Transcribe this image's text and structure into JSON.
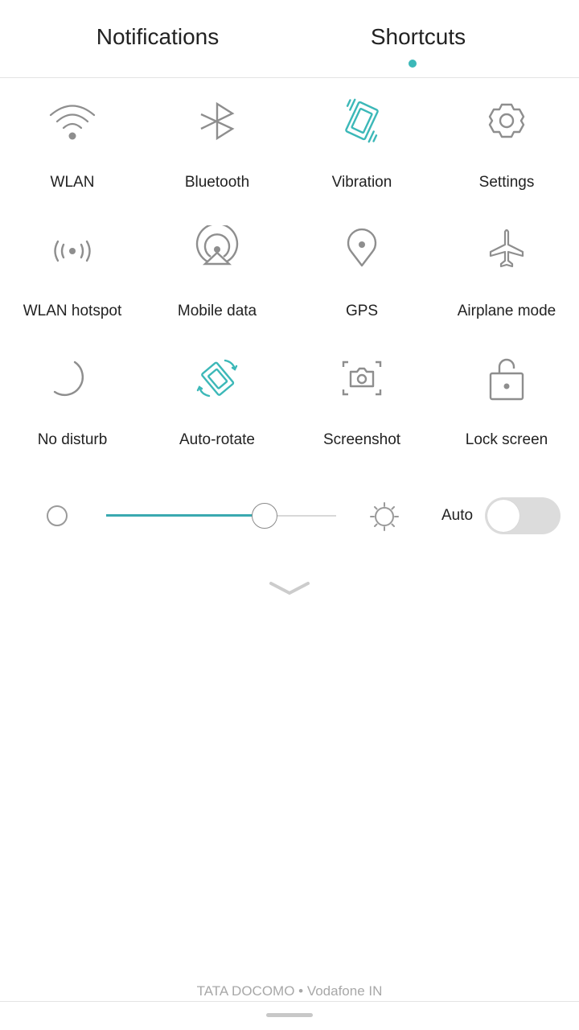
{
  "tabs": [
    {
      "label": "Notifications",
      "active": false
    },
    {
      "label": "Shortcuts",
      "active": true
    }
  ],
  "colors": {
    "accent": "#3cb8b8",
    "icon_inactive": "#8e8e8e",
    "slider_fill": "#3aa9b0"
  },
  "shortcuts": [
    {
      "label": "WLAN",
      "icon": "wifi-icon",
      "active": false
    },
    {
      "label": "Bluetooth",
      "icon": "bluetooth-icon",
      "active": false
    },
    {
      "label": "Vibration",
      "icon": "vibration-icon",
      "active": true
    },
    {
      "label": "Settings",
      "icon": "gear-icon",
      "active": false
    },
    {
      "label": "WLAN hotspot",
      "icon": "hotspot-icon",
      "active": false
    },
    {
      "label": "Mobile data",
      "icon": "mobile-data-icon",
      "active": false
    },
    {
      "label": "GPS",
      "icon": "location-pin-icon",
      "active": false
    },
    {
      "label": "Airplane mode",
      "icon": "airplane-icon",
      "active": false
    },
    {
      "label": "No disturb",
      "icon": "moon-icon",
      "active": false
    },
    {
      "label": "Auto-rotate",
      "icon": "auto-rotate-icon",
      "active": true
    },
    {
      "label": "Screenshot",
      "icon": "screenshot-icon",
      "active": false
    },
    {
      "label": "Lock screen",
      "icon": "unlock-icon",
      "active": false
    }
  ],
  "brightness": {
    "value_percent": 69,
    "auto_label": "Auto",
    "auto_enabled": false
  },
  "footer": {
    "carrier": "TATA DOCOMO • Vodafone IN"
  }
}
